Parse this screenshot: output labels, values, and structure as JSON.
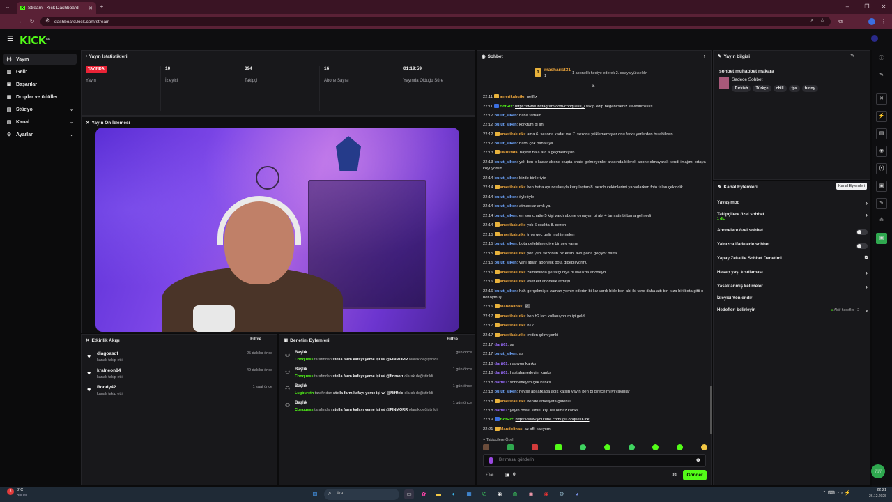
{
  "browser": {
    "tab_title": "Stream - Kick Dashboard",
    "url": "dashboard.kick.com/stream",
    "new_tab": "+"
  },
  "app": {
    "logo": "KICK",
    "logo_sup": "beta"
  },
  "sidebar": {
    "items": [
      {
        "label": "Yayın",
        "icon": "broadcast-icon",
        "glyph": "(•)"
      },
      {
        "label": "Gelir",
        "icon": "revenue-icon",
        "glyph": "▤"
      },
      {
        "label": "Başarılar",
        "icon": "achievements-icon",
        "glyph": "▤"
      },
      {
        "label": "Droplar ve ödüller",
        "icon": "gift-icon",
        "glyph": "▤"
      },
      {
        "label": "Stüdyo",
        "icon": "studio-icon",
        "glyph": "▤"
      },
      {
        "label": "Kanal",
        "icon": "channel-icon",
        "glyph": "▤"
      },
      {
        "label": "Ayarlar",
        "icon": "settings-icon",
        "glyph": "⚙"
      }
    ]
  },
  "stats": {
    "title": "Yayın İstatistikleri",
    "live_badge": "YAYINDA",
    "live_label": "Yayın",
    "viewers": "10",
    "viewers_label": "İzleyici",
    "followers": "394",
    "followers_label": "Takipçi",
    "subs": "16",
    "subs_label": "Abone Sayısı",
    "duration": "01:19:59",
    "duration_label": "Yayında Olduğu Süre"
  },
  "preview": {
    "title": "Yayın Ön İzlemesi"
  },
  "activity": {
    "title": "Etkinlik Akışı",
    "filter": "Filtre",
    "items": [
      {
        "name": "diagoasdf",
        "sub": "kanalı takip etti",
        "time": "25 dakika önce"
      },
      {
        "name": "kralneon84",
        "sub": "kanalı takip etti",
        "time": "49 dakika önce"
      },
      {
        "name": "Roody42",
        "sub": "kanalı takip etti",
        "time": "1 saat önce"
      }
    ]
  },
  "moderation": {
    "title": "Denetim Eylemleri",
    "filter": "Filtre",
    "items": [
      {
        "title": "Başlık",
        "user": "Conquess",
        "mid": "tarafından",
        "value": "stella farm kafayı yeme işi w/ @FINMORR",
        "end": "olarak değiştirildi",
        "time": "1 gün önce"
      },
      {
        "title": "Başlık",
        "user": "Conquess",
        "mid": "tarafından",
        "value": "stella farm kafayı yeme işi w/ @finmorr",
        "end": "olarak değiştirildi",
        "time": "1 gün önce"
      },
      {
        "title": "Başlık",
        "user": "Lugbureth",
        "mid": "tarafından",
        "value": "stella farm kafayı yeme işi w/ @Nifffels",
        "end": "olarak değiştirildi",
        "time": "1 gün önce"
      },
      {
        "title": "Başlık",
        "user": "Conquess",
        "mid": "tarafından",
        "value": "stella farm kafayı yeme işi w/ @FINMORR",
        "end": "olarak değiştirildi",
        "time": "1 gün önce"
      }
    ]
  },
  "chat": {
    "title": "Sohbet",
    "gifter": "masharist31",
    "gifter_count": "1",
    "gift_text": "1 abonelik hediye ederek 2. sıraya yükseldin",
    "messages": [
      {
        "t": "22:11",
        "u": "amerikalıutkı",
        "c": "#e8a33c",
        "m": "netflix"
      },
      {
        "t": "22:11",
        "u": "BotRix",
        "c": "#53fc18",
        "m": "",
        "link": "https://www.instagram.com/conquess_/",
        "after": " takip edip beğenirseniz sevinirimssss"
      },
      {
        "t": "22:12",
        "u": "bulut_siken",
        "c": "#6fa7ff",
        "m": "haha tamam"
      },
      {
        "t": "22:12",
        "u": "bulut_siken",
        "c": "#6fa7ff",
        "m": "korktum bi an"
      },
      {
        "t": "22:12",
        "u": "amerikalıutkı",
        "c": "#e8a33c",
        "m": "ama 6. sezona kadar var 7. sezonu yüklememişler onu farklı yerlerden bulabilirsin"
      },
      {
        "t": "22:12",
        "u": "bulut_siken",
        "c": "#6fa7ff",
        "m": "harbi çok pahalı ya"
      },
      {
        "t": "22:13",
        "u": "0Mustafa",
        "c": "#e8a33c",
        "m": "hayret hala arc a geçmemişsin"
      },
      {
        "t": "22:13",
        "u": "bulut_siken",
        "c": "#6fa7ff",
        "m": "yok ben o kadar abone olupta chate gelmeyenler arasında bilerek abone olmayarak kendi imajımı ortaya koyuyorum"
      },
      {
        "t": "22:14",
        "u": "bulut_siken",
        "c": "#6fa7ff",
        "m": "bizde birileriyiz"
      },
      {
        "t": "22:14",
        "u": "amerikalıutkı",
        "c": "#e8a33c",
        "m": "ben hatta oyuncularıyla karşılaştım 8. sezob çekimlerimi yaparlarken foto falan çekindik"
      },
      {
        "t": "22:14",
        "u": "bulut_siken",
        "c": "#6fa7ff",
        "m": "öyleöyle"
      },
      {
        "t": "22:14",
        "u": "bulut_siken",
        "c": "#6fa7ff",
        "m": "atmadılar amk ya"
      },
      {
        "t": "22:14",
        "u": "bulut_siken",
        "c": "#6fa7ff",
        "m": "en son chatte 5 kişi vardı abone olmayan bi abi 4 tanı attı bi bana gelmedi"
      },
      {
        "t": "22:14",
        "u": "amerikalıutkı",
        "c": "#e8a33c",
        "m": "yok 6 ocakta 8. sezon"
      },
      {
        "t": "22:15",
        "u": "amerikalıutkı",
        "c": "#e8a33c",
        "m": "tr ye geç gelir muhtemelen"
      },
      {
        "t": "22:15",
        "u": "bulut_siken",
        "c": "#6fa7ff",
        "m": "bota gelebilme diye bir şey varmı"
      },
      {
        "t": "22:15",
        "u": "amerikalıutkı",
        "c": "#e8a33c",
        "m": "yok yeni sezonun bir kısmı avrupada geçiyor hatta"
      },
      {
        "t": "22:15",
        "u": "bulut_siken",
        "c": "#6fa7ff",
        "m": "yani atılan abonelik bota gidebiliyormu"
      },
      {
        "t": "22:16",
        "u": "amerikalıutkı",
        "c": "#e8a33c",
        "m": "zamanında şerlatçı diye bi lavukda aboneydi"
      },
      {
        "t": "22:16",
        "u": "amerikalıutkı",
        "c": "#e8a33c",
        "m": "evet elif abonelik atmıştı"
      },
      {
        "t": "22:16",
        "u": "bulut_siken",
        "c": "#6fa7ff",
        "m": "hah gerçekmiş o zaman yemin ederim bi kız vardı bide ben abi iki tane daha attı biri kıza biri bota gitti o bot oymuş"
      },
      {
        "t": "22:16",
        "u": "Mandolinas",
        "c": "#e8a33c",
        "m": "🖼"
      },
      {
        "t": "22:17",
        "u": "amerikalıutkı",
        "c": "#e8a33c",
        "m": "ben b2 lacı kullanıyorum iyi geldi"
      },
      {
        "t": "22:17",
        "u": "amerikalıutkı",
        "c": "#e8a33c",
        "m": "b12"
      },
      {
        "t": "22:17",
        "u": "amerikalıutkı",
        "c": "#e8a33c",
        "m": "evden çıkmıyonki"
      },
      {
        "t": "22:17",
        "u": "darti61",
        "c": "#9a6cff",
        "m": "sa"
      },
      {
        "t": "22:17",
        "u": "bulut_siken",
        "c": "#6fa7ff",
        "m": "as"
      },
      {
        "t": "22:18",
        "u": "darti61",
        "c": "#9a6cff",
        "m": "napıyon kanks"
      },
      {
        "t": "22:18",
        "u": "darti61",
        "c": "#9a6cff",
        "m": "hastahanedeyim kanks"
      },
      {
        "t": "22:18",
        "u": "darti61",
        "c": "#9a6cff",
        "m": "sohbetteyim çek kanks"
      },
      {
        "t": "22:18",
        "u": "bulut_siken",
        "c": "#6fa7ff",
        "m": "neyse abi arkada açık kalsın yayın ben bi gireceım iyi yayınlar"
      },
      {
        "t": "22:18",
        "u": "amerikalıutkı",
        "c": "#e8a33c",
        "m": "bende ameliyata gidenzi"
      },
      {
        "t": "22:18",
        "u": "darti61",
        "c": "#9a6cff",
        "m": "yayın odası sınırlı kişi ise olmaz kanks"
      },
      {
        "t": "22:19",
        "u": "BotRix",
        "c": "#53fc18",
        "m": "",
        "link": "https://www.youtube.com/@ConquesKick",
        "after": ""
      },
      {
        "t": "22:21",
        "u": "Mandolinas",
        "c": "#e8a33c",
        "m": "az afk kalıyom"
      }
    ],
    "followers_only": "Takipçilere Özel",
    "placeholder": "Bir mesaj gönderin",
    "count": "0",
    "send": "Gönder"
  },
  "stream_info": {
    "title": "Yayın bilgisi",
    "stream_title": "sohbet muhabbet makara",
    "category": "Sadece Sohbet",
    "tags": [
      "Turkish",
      "Türkçe",
      "chill",
      "fps",
      "funny"
    ]
  },
  "channel_actions": {
    "title": "Kanal Eylemleri",
    "tooltip": "Kanal Eylemleri",
    "rows": [
      {
        "label": "Yavaş mod",
        "kind": "chevron"
      },
      {
        "label": "Takipçilere özel sohbet",
        "sub": "1 dk.",
        "kind": "chevron"
      },
      {
        "label": "Abonelere özel sohbet",
        "kind": "toggle"
      },
      {
        "label": "Yalnızca ifadelerle sohbet",
        "kind": "toggle"
      },
      {
        "label": "Yapay Zeka ile Sohbet Denetimi",
        "kind": "external"
      },
      {
        "label": "Hesap yaşı kısıtlaması",
        "kind": "chevron"
      },
      {
        "label": "Yasaklanmış kelimeler",
        "kind": "chevron"
      },
      {
        "label": "İzleyici Yönlendir",
        "kind": "none"
      },
      {
        "label": "Hedefleri belirleyin",
        "kind": "chevron",
        "extra": "Aktif hedefler - 2"
      }
    ]
  },
  "taskbar": {
    "weather_temp": "8°C",
    "weather_desc": "Bulutlu",
    "search": "Ara",
    "time": "22:21",
    "date": "26.12.2025",
    "badge": "3"
  },
  "colors": {
    "brand": "#53fc18",
    "live": "#ea2336"
  }
}
